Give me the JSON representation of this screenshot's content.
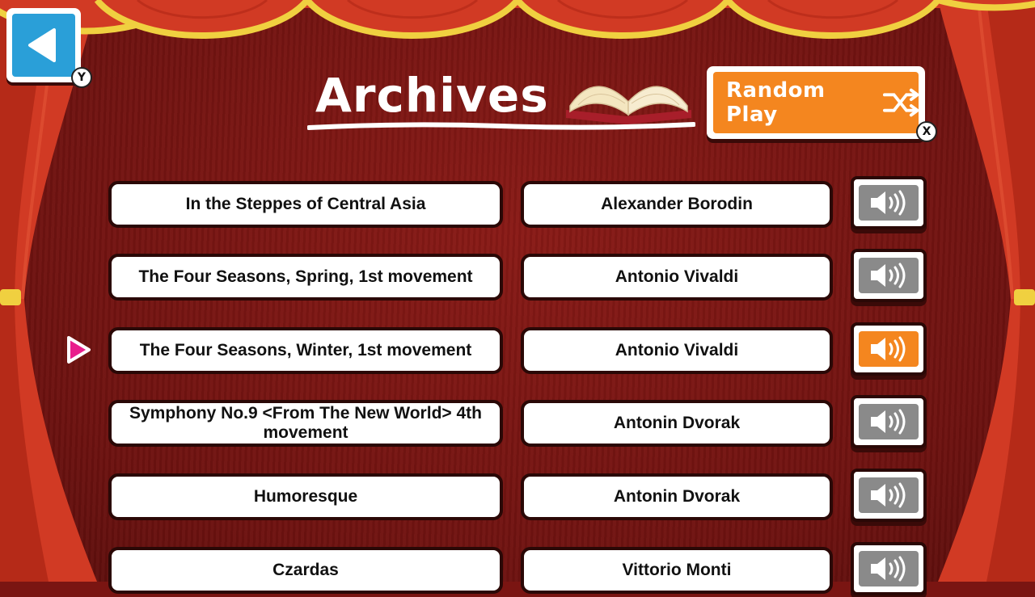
{
  "header": {
    "back_button_hint": "Y",
    "title": "Archives",
    "random_play_label": "Random Play",
    "random_play_hint": "X"
  },
  "colors": {
    "accent_orange": "#f4861f",
    "back_blue": "#2a9fd8",
    "cursor_pink": "#e91e8c",
    "inactive_gray": "#8a8a8a",
    "curtain_red": "#d13a24",
    "gold_trim": "#f0d040"
  },
  "icons": {
    "back": "left-triangle-icon",
    "book": "open-book-icon",
    "shuffle": "shuffle-icon",
    "sound": "speaker-icon",
    "cursor": "pink-triangle-cursor-icon"
  },
  "tracks": [
    {
      "title": "In the Steppes of Central Asia",
      "composer": "Alexander Borodin",
      "playing": false
    },
    {
      "title": "The Four Seasons, Spring, 1st movement",
      "composer": "Antonio Vivaldi",
      "playing": false
    },
    {
      "title": "The Four Seasons, Winter, 1st movement",
      "composer": "Antonio Vivaldi",
      "playing": true
    },
    {
      "title": "Symphony No.9 <From The New World> 4th movement",
      "composer": "Antonin Dvorak",
      "playing": false
    },
    {
      "title": "Humoresque",
      "composer": "Antonin Dvorak",
      "playing": false
    },
    {
      "title": "Czardas",
      "composer": "Vittorio Monti",
      "playing": false
    }
  ]
}
